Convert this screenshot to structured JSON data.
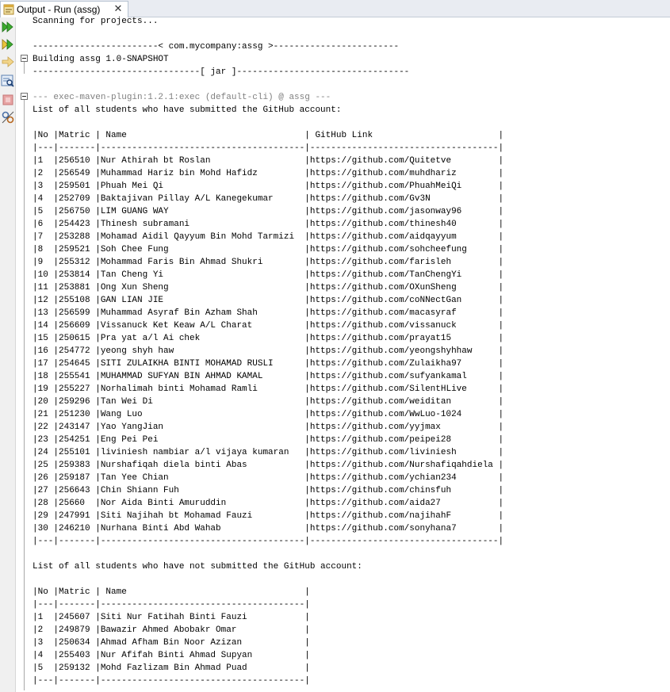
{
  "tab": {
    "title": "Output - Run (assg)",
    "close_glyph": "✕",
    "icon": "output-window-icon"
  },
  "toolbar": {
    "buttons": [
      {
        "name": "rerun-icon"
      },
      {
        "name": "rerun-with-options-icon"
      },
      {
        "name": "stop-arrow-icon"
      },
      {
        "name": "inspect-icon"
      },
      {
        "name": "stop-icon"
      },
      {
        "name": "settings-icon"
      }
    ]
  },
  "output": {
    "lines": [
      {
        "text": "Scanning for projects...",
        "style": "normal"
      },
      {
        "text": "",
        "style": "normal"
      },
      {
        "text": "------------------------< com.mycompany:assg >------------------------",
        "style": "normal"
      },
      {
        "text": "Building assg 1.0-SNAPSHOT",
        "style": "normal"
      },
      {
        "text": "--------------------------------[ jar ]---------------------------------",
        "style": "normal"
      },
      {
        "text": "",
        "style": "normal"
      },
      {
        "text": "--- exec-maven-plugin:1.2.1:exec (default-cli) @ assg ---",
        "style": "muted"
      },
      {
        "text": "List of all students who have submitted the GitHub account:",
        "style": "normal"
      },
      {
        "text": "",
        "style": "normal"
      },
      {
        "text": "|No |Matric | Name                                  | GitHub Link                        |",
        "style": "normal"
      },
      {
        "text": "|---|-------|---------------------------------------|------------------------------------|",
        "style": "normal"
      },
      {
        "text": "|1  |256510 |Nur Athirah bt Roslan                  |https://github.com/Quitetve         |",
        "style": "normal"
      },
      {
        "text": "|2  |256549 |Muhammad Hariz bin Mohd Hafidz         |https://github.com/muhdhariz        |",
        "style": "normal"
      },
      {
        "text": "|3  |259501 |Phuah Mei Qi                           |https://github.com/PhuahMeiQi       |",
        "style": "normal"
      },
      {
        "text": "|4  |252709 |Baktajivan Pillay A/L Kanegekumar      |https://github.com/Gv3N             |",
        "style": "normal"
      },
      {
        "text": "|5  |256750 |LIM GUANG WAY                          |https://github.com/jasonway96       |",
        "style": "normal"
      },
      {
        "text": "|6  |254423 |Thinesh subramani                      |https://github.com/thinesh40        |",
        "style": "normal"
      },
      {
        "text": "|7  |253288 |Mohamad Aidil Qayyum Bin Mohd Tarmizi  |https://github.com/aidqayyum        |",
        "style": "normal"
      },
      {
        "text": "|8  |259521 |Soh Chee Fung                          |https://github.com/sohcheefung      |",
        "style": "normal"
      },
      {
        "text": "|9  |255312 |Mohammad Faris Bin Ahmad Shukri        |https://github.com/farisleh         |",
        "style": "normal"
      },
      {
        "text": "|10 |253814 |Tan Cheng Yi                           |https://github.com/TanChengYi       |",
        "style": "normal"
      },
      {
        "text": "|11 |253881 |Ong Xun Sheng                          |https://github.com/OXunSheng        |",
        "style": "normal"
      },
      {
        "text": "|12 |255108 |GAN LIAN JIE                           |https://github.com/coNNectGan       |",
        "style": "normal"
      },
      {
        "text": "|13 |256599 |Muhammad Asyraf Bin Azham Shah         |https://github.com/macasyraf        |",
        "style": "normal"
      },
      {
        "text": "|14 |256609 |Vissanuck Ket Keaw A/L Charat          |https://github.com/vissanuck        |",
        "style": "normal"
      },
      {
        "text": "|15 |250615 |Pra yat a/l Ai chek                    |https://github.com/prayat15         |",
        "style": "normal"
      },
      {
        "text": "|16 |254772 |yeong shyh haw                         |https://github.com/yeongshyhhaw     |",
        "style": "normal"
      },
      {
        "text": "|17 |254645 |SITI ZULAIKHA BINTI MOHAMAD RUSLI      |https://github.com/Zulaikha97       |",
        "style": "normal"
      },
      {
        "text": "|18 |255541 |MUHAMMAD SUFYAN BIN AHMAD KAMAL        |https://github.com/sufyankamal      |",
        "style": "normal"
      },
      {
        "text": "|19 |255227 |Norhalimah binti Mohamad Ramli         |https://github.com/SilentHLive      |",
        "style": "normal"
      },
      {
        "text": "|20 |259296 |Tan Wei Di                             |https://github.com/weiditan         |",
        "style": "normal"
      },
      {
        "text": "|21 |251230 |Wang Luo                               |https://github.com/WwLuo-1024       |",
        "style": "normal"
      },
      {
        "text": "|22 |243147 |Yao YangJian                           |https://github.com/yyjmax           |",
        "style": "normal"
      },
      {
        "text": "|23 |254251 |Eng Pei Pei                            |https://github.com/peipei28         |",
        "style": "normal"
      },
      {
        "text": "|24 |255101 |liviniesh nambiar a/l vijaya kumaran   |https://github.com/liviniesh        |",
        "style": "normal"
      },
      {
        "text": "|25 |259383 |Nurshafiqah diela binti Abas           |https://github.com/Nurshafiqahdiela |",
        "style": "normal"
      },
      {
        "text": "|26 |259187 |Tan Yee Chian                          |https://github.com/ychian234        |",
        "style": "normal"
      },
      {
        "text": "|27 |256643 |Chin Shiann Fuh                        |https://github.com/chinsfuh         |",
        "style": "normal"
      },
      {
        "text": "|28 |25660  |Nor Aida Binti Amuruddin               |https://github.com/aida27           |",
        "style": "normal"
      },
      {
        "text": "|29 |247991 |Siti Najihah bt Mohamad Fauzi          |https://github.com/najihahF         |",
        "style": "normal"
      },
      {
        "text": "|30 |246210 |Nurhana Binti Abd Wahab                |https://github.com/sonyhana7        |",
        "style": "normal"
      },
      {
        "text": "|---|-------|---------------------------------------|------------------------------------|",
        "style": "normal"
      },
      {
        "text": "",
        "style": "normal"
      },
      {
        "text": "List of all students who have not submitted the GitHub account:",
        "style": "normal"
      },
      {
        "text": "",
        "style": "normal"
      },
      {
        "text": "|No |Matric | Name                                  |",
        "style": "normal"
      },
      {
        "text": "|---|-------|---------------------------------------|",
        "style": "normal"
      },
      {
        "text": "|1  |245607 |Siti Nur Fatihah Binti Fauzi           |",
        "style": "normal"
      },
      {
        "text": "|2  |249879 |Bawazir Ahmed Abobakr Omar             |",
        "style": "normal"
      },
      {
        "text": "|3  |250634 |Ahmad Afham Bin Noor Azizan            |",
        "style": "normal"
      },
      {
        "text": "|4  |255403 |Nur Afifah Binti Ahmad Supyan          |",
        "style": "normal"
      },
      {
        "text": "|5  |259132 |Mohd Fazlizam Bin Ahmad Puad           |",
        "style": "normal"
      },
      {
        "text": "|---|-------|---------------------------------------|",
        "style": "normal"
      }
    ]
  }
}
